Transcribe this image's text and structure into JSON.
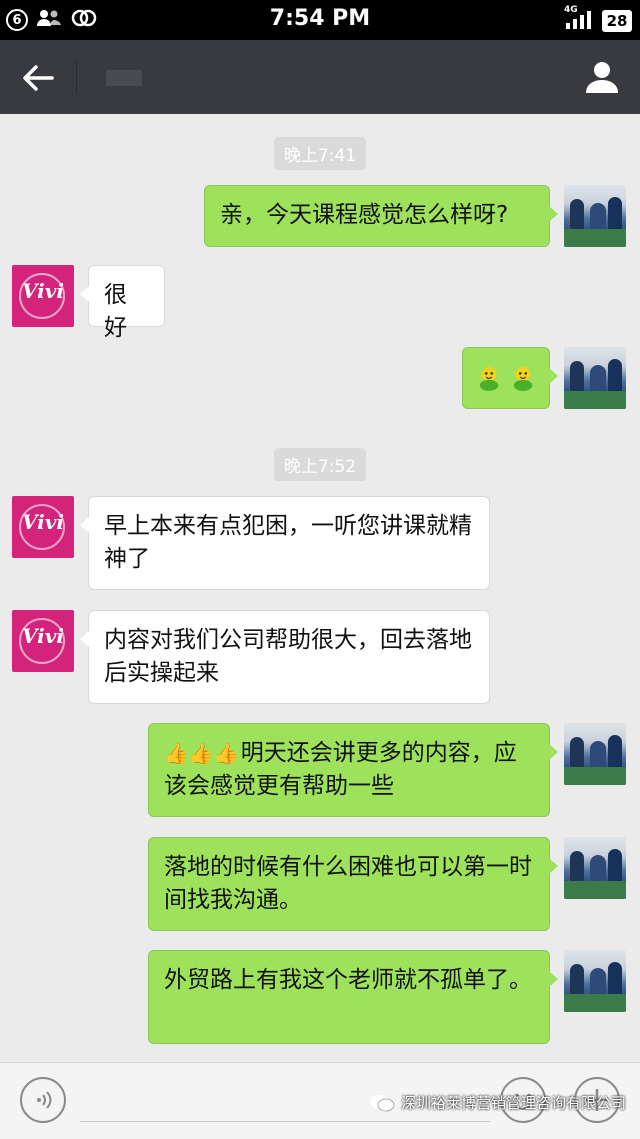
{
  "status_bar": {
    "notification_count": "6",
    "time": "7:54 PM",
    "network": "4G",
    "battery": "28",
    "icons": [
      "notification-badge",
      "contacts-icon",
      "link-icon",
      "signal-icon"
    ]
  },
  "title_bar": {
    "back_icon": "arrow-left-icon",
    "profile_icon": "person-icon"
  },
  "messages": {
    "ts1": "晚上7:41",
    "m1": "亲，今天课程感觉怎么样呀?",
    "m2": "很好",
    "ts2": "晚上7:52",
    "m4": "早上本来有点犯困，一听您讲课就精神了",
    "m5": "内容对我们公司帮助很大，回去落地后实操起来",
    "m6_text": "明天还会讲更多的内容，应该会感觉更有帮助一些",
    "m6_thumbs": "👍👍👍",
    "m7": "落地的时候有什么困难也可以第一时间找我沟通。",
    "m8": "外贸路上有我这个老师就不孤单了。"
  },
  "avatars": {
    "contact_logo_text": "Vivi"
  },
  "input_bar": {
    "icons": [
      "voice-icon",
      "emoji-icon",
      "plus-icon"
    ]
  },
  "watermark": {
    "text": "深圳裕莱博营销管理咨询有限公司"
  },
  "colors": {
    "outgoing_bubble": "#9ee25b",
    "incoming_bubble": "#ffffff",
    "title_bar": "#393a3f",
    "background": "#ebebeb",
    "contact_avatar": "#d3237a"
  }
}
